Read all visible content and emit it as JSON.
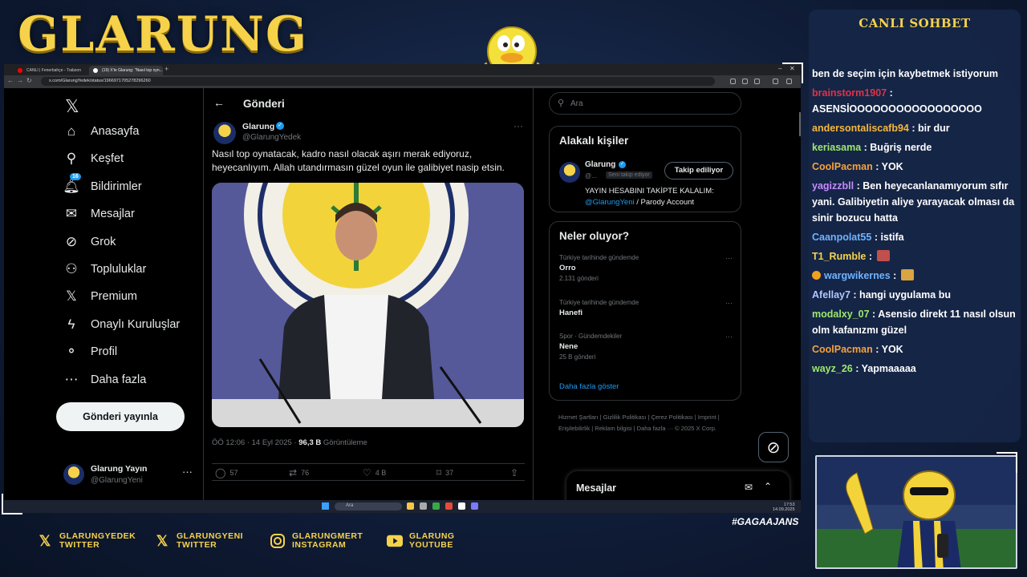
{
  "overlay": {
    "brand": "GLARUNG",
    "chat_title": "CANLI SOHBET",
    "hashtag": "#GAGAAJANS",
    "socials": [
      {
        "icon": "x-icon",
        "line1": "GLARUNGYEDEK",
        "line2": "TWITTER"
      },
      {
        "icon": "x-icon",
        "line1": "GLARUNGYENI",
        "line2": "TWITTER"
      },
      {
        "icon": "instagram-icon",
        "line1": "GLARUNGMERT",
        "line2": "INSTAGRAM"
      },
      {
        "icon": "youtube-icon",
        "line1": "GLARUNG",
        "line2": "YOUTUBE"
      }
    ],
    "chat": [
      {
        "user": "",
        "text": "ben de seçim için kaybetmek istiyorum",
        "color": "#ffffff"
      },
      {
        "user": "brainstorm1907",
        "text": " : ASENSİOOOOOOOOOOOOOOOOO",
        "color": "#e0324a"
      },
      {
        "user": "andersontaliscafb94",
        "text": " : bir dur",
        "color": "#f6b73c"
      },
      {
        "user": "keriasama",
        "text": " : Buğriş nerde",
        "color": "#9ee86b"
      },
      {
        "user": "CoolPacman",
        "text": " : YOK",
        "color": "#f6a23c"
      },
      {
        "user": "yagizzbll",
        "text": " : Ben heyecanlanamıyorum sıfır yani. Galibiyetin aliye yarayacak olması da sinir bozucu hatta",
        "color": "#c58bff"
      },
      {
        "user": "Caanpolat55",
        "text": " : istifa",
        "color": "#6fb3ff"
      },
      {
        "user": "T1_Rumble",
        "text": " : ",
        "color": "#f6d24a",
        "emote": "#c0504d"
      },
      {
        "user": "wargwikernes",
        "text": " : ",
        "color": "#6fb3ff",
        "emote": "#d9a441",
        "badge": true
      },
      {
        "user": "Afellay7",
        "text": " : hangi uygulama bu",
        "color": "#b0c8ff"
      },
      {
        "user": "modalxy_07",
        "text": " : Asensio direkt 11 nasıl olsun olm kafanızmı güzel",
        "color": "#9ee86b"
      },
      {
        "user": "CoolPacman",
        "text": " : YOK",
        "color": "#f6a23c"
      },
      {
        "user": "wayz_26",
        "text": " : Yapmaaaaa",
        "color": "#9ee86b"
      }
    ]
  },
  "browser": {
    "tabs": [
      {
        "label": "CANLI | Fenerbahçe - Trabzon",
        "dot": "#ff0000"
      },
      {
        "label": "(19) X'te Glarung: \"Nasıl top oyn...",
        "dot": "#ffffff"
      }
    ],
    "url": "x.com/GlarungYedek/status/1966971705278296260"
  },
  "nav": {
    "items": [
      {
        "name": "nav-home",
        "icon": "home-icon",
        "glyph": "⌂",
        "label": "Anasayfa"
      },
      {
        "name": "nav-explore",
        "icon": "search-icon",
        "glyph": "⚲",
        "label": "Keşfet"
      },
      {
        "name": "nav-notifications",
        "icon": "bell-icon",
        "glyph": "🔔︎",
        "label": "Bildirimler"
      },
      {
        "name": "nav-messages",
        "icon": "mail-icon",
        "glyph": "✉",
        "label": "Mesajlar"
      },
      {
        "name": "nav-grok",
        "icon": "grok-icon",
        "glyph": "⊘",
        "label": "Grok"
      },
      {
        "name": "nav-communities",
        "icon": "communities-icon",
        "glyph": "⚇",
        "label": "Topluluklar"
      },
      {
        "name": "nav-premium",
        "icon": "x-icon",
        "glyph": "𝕏",
        "label": "Premium"
      },
      {
        "name": "nav-verified-orgs",
        "icon": "lightning-icon",
        "glyph": "ϟ",
        "label": "Onaylı Kuruluşlar"
      },
      {
        "name": "nav-profile",
        "icon": "person-icon",
        "glyph": "⚬",
        "label": "Profil"
      },
      {
        "name": "nav-more",
        "icon": "more-icon",
        "glyph": "⋯",
        "label": "Daha fazla"
      }
    ],
    "notif_count": "16",
    "post_button": "Gönderi yayınla",
    "account_name": "Glarung Yayın",
    "account_handle": "@GlarungYeni"
  },
  "post": {
    "header": "Gönderi",
    "author": "Glarung",
    "handle": "@GlarungYedek",
    "text": "Nasıl top oynatacak, kadro nasıl olacak aşırı merak ediyoruz, heyecanlıyım. Allah utandırmasın güzel oyun ile galibiyet nasip etsin.",
    "time": "ÖÖ 12:06 · 14 Eyl 2025 · ",
    "views": "96,3 B",
    "views_label": " Görüntüleme",
    "replies": "57",
    "reposts": "76",
    "likes": "4 B",
    "bookmarks": "37"
  },
  "sidebar": {
    "search_placeholder": "Ara",
    "relevant_title": "Alakalı kişiler",
    "relevant_name": "Glarung",
    "relevant_handle": "@...",
    "follows_you": "Seni takip ediyor",
    "following_button": "Takip ediliyor",
    "bio_line1": "YAYIN HESABINI TAKİPTE KALALIM:",
    "bio_link": "@GlarungYeni",
    "bio_line2": " / Parody Account",
    "trends_title": "Neler oluyor?",
    "trends": [
      {
        "context": "Türkiye tarihinde gündemde",
        "name": "Orro",
        "count": "2.131 gönderi"
      },
      {
        "context": "Türkiye tarihinde gündemde",
        "name": "Hanefi",
        "count": ""
      },
      {
        "context": "Spor · Gündemdekiler",
        "name": "Nene",
        "count": "25 B gönderi"
      }
    ],
    "show_more": "Daha fazla göster",
    "footer": "Hizmet Şartları  |  Gizlilik Politikası  |  Çerez Politikası  |  Imprint  |  Erişilebilirlik  |  Reklam bilgisi  |  Daha fazla ···  © 2025 X Corp.",
    "messages_title": "Mesajlar"
  },
  "taskbar": {
    "search": "Ara",
    "time": "17:53",
    "date": "14.09.2025"
  },
  "colors": {
    "accent_gold": "#f6d24a",
    "x_blue": "#1d9bf0",
    "x_text": "#e7e9ea",
    "x_muted": "#71767b"
  }
}
